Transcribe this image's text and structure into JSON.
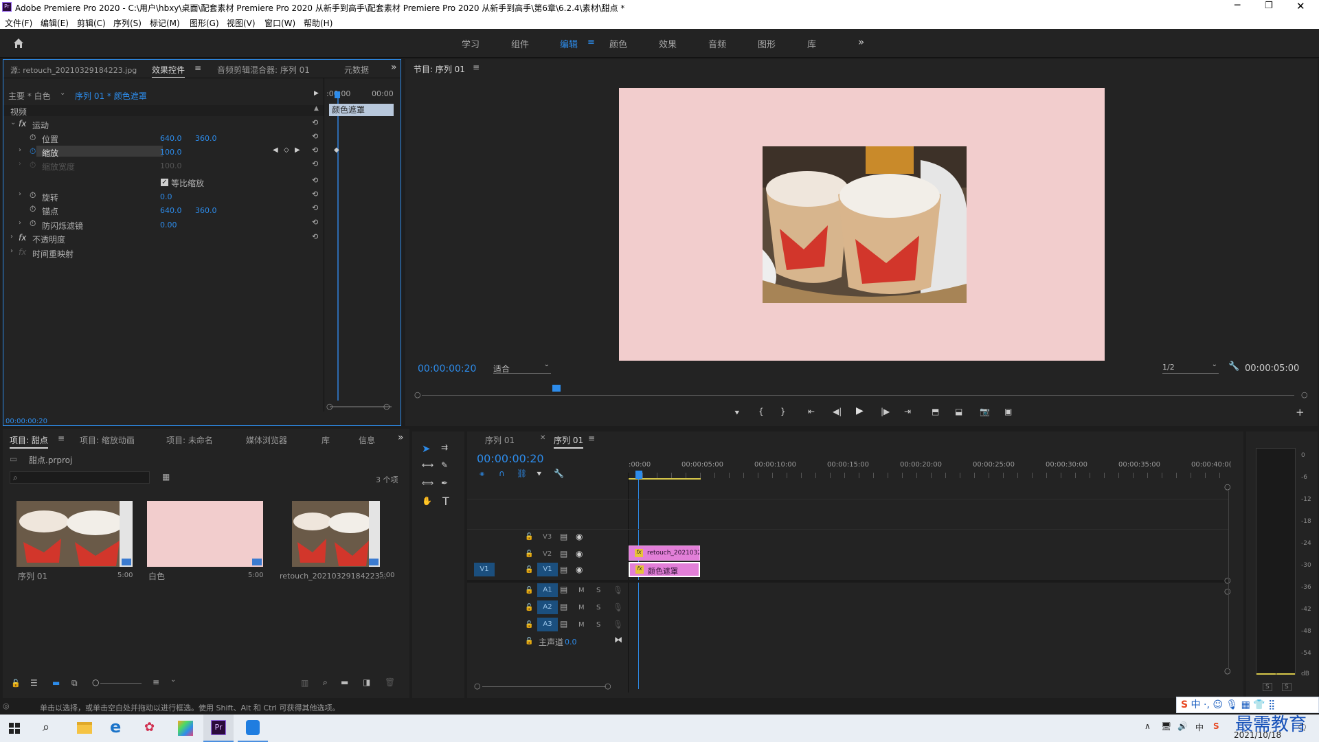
{
  "window": {
    "title": "Adobe Premiere Pro 2020 - C:\\用户\\hbxy\\桌面\\配套素材 Premiere Pro 2020 从新手到高手\\配套素材 Premiere Pro 2020 从新手到高手\\第6章\\6.2.4\\素材\\甜点 *"
  },
  "menu": [
    "文件(F)",
    "编辑(E)",
    "剪辑(C)",
    "序列(S)",
    "标记(M)",
    "图形(G)",
    "视图(V)",
    "窗口(W)",
    "帮助(H)"
  ],
  "workspaces": [
    "学习",
    "组件",
    "编辑",
    "颜色",
    "效果",
    "音频",
    "图形",
    "库"
  ],
  "effect_panel": {
    "tabs": [
      "源: retouch_20210329184223.jpg",
      "效果控件",
      "音频剪辑混合器: 序列 01",
      "元数据"
    ],
    "master": "主要 * 白色",
    "sequence": "序列 01 * 颜色遮罩",
    "time_start": ":00:00",
    "time_end": "00:00",
    "clip_label": "颜色遮罩",
    "section_video": "视频",
    "fx_motion": "运动",
    "props": [
      {
        "label": "位置",
        "v1": "640.0",
        "v2": "360.0"
      },
      {
        "label": "缩放",
        "v1": "100.0",
        "v2": ""
      },
      {
        "label": "缩放宽度",
        "v1": "100.0",
        "v2": ""
      },
      {
        "label": "等比缩放",
        "v1": "",
        "v2": ""
      },
      {
        "label": "旋转",
        "v1": "0.0",
        "v2": ""
      },
      {
        "label": "锚点",
        "v1": "640.0",
        "v2": "360.0"
      },
      {
        "label": "防闪烁滤镜",
        "v1": "0.00",
        "v2": ""
      }
    ],
    "fx_opacity": "不透明度",
    "fx_time": "时间重映射",
    "current_time": "00:00:00:20"
  },
  "program": {
    "title": "节目: 序列 01",
    "timecode": "00:00:00:20",
    "fit": "适合",
    "resolution": "1/2",
    "duration": "00:00:05:00",
    "bg_color": "#f2cdcd"
  },
  "project": {
    "tabs": [
      "项目: 甜点",
      "项目: 缩放动画",
      "项目: 未命名",
      "媒体浏览器",
      "库",
      "信息"
    ],
    "file": "甜点.prproj",
    "count": "3 个项",
    "items": [
      {
        "name": "序列 01",
        "duration": "5:00"
      },
      {
        "name": "白色",
        "duration": "5:00"
      },
      {
        "name": "retouch_20210329184223...",
        "duration": "5:00"
      }
    ]
  },
  "timeline": {
    "tabs": [
      "序列 01",
      "序列 01"
    ],
    "timecode": "00:00:00:20",
    "ruler": [
      ":00:00",
      "00:00:05:00",
      "00:00:10:00",
      "00:00:15:00",
      "00:00:20:00",
      "00:00:25:00",
      "00:00:30:00",
      "00:00:35:00",
      "00:00:40:0("
    ],
    "video_tracks": [
      "V3",
      "V2",
      "V1"
    ],
    "audio_tracks": [
      "A1",
      "A2",
      "A3"
    ],
    "source_patch": "V1",
    "master_label": "主声道",
    "master_value": "0.0",
    "clip_v2": "retouch_2021032",
    "clip_v1": "颜色遮罩",
    "ms": [
      "M",
      "S"
    ]
  },
  "meter": {
    "ticks": [
      "0",
      "-6",
      "-12",
      "-18",
      "-24",
      "-30",
      "-36",
      "-42",
      "-48",
      "-54",
      "dB"
    ],
    "solo": [
      "S",
      "S"
    ]
  },
  "status": "单击以选择，或单击空白处并拖动以进行框选。使用 Shift、Alt 和 Ctrl 可获得其他选项。",
  "taskbar": {
    "date": "2021/10/18",
    "ime": "中",
    "watermark": "最需教育"
  },
  "colors": {
    "accent": "#2d8ceb",
    "clip_pink": "#e27fd8",
    "mask_pink": "#f2cdcd"
  }
}
